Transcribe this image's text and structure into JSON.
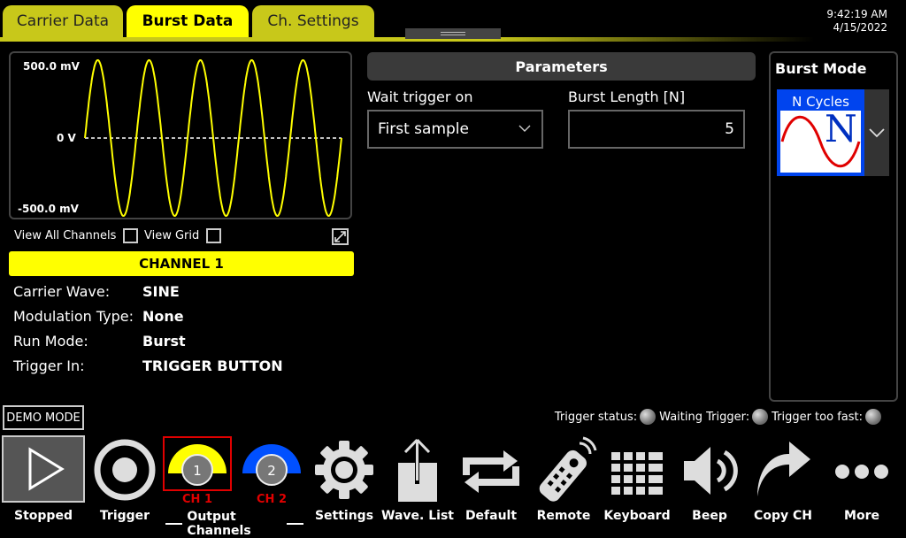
{
  "tabs": [
    {
      "label": "Carrier Data",
      "active": false
    },
    {
      "label": "Burst Data",
      "active": true
    },
    {
      "label": "Ch. Settings",
      "active": false
    }
  ],
  "clock": {
    "time": "9:42:19 AM",
    "date": "4/15/2022"
  },
  "waveform": {
    "top_label": "500.0 mV",
    "mid_label": "0 V",
    "bottom_label": "-500.0 mV",
    "cycles": 5,
    "color": "#ffff00"
  },
  "view": {
    "all_channels_label": "View All Channels",
    "grid_label": "View Grid",
    "all_channels_checked": false,
    "grid_checked": false
  },
  "channel": {
    "title": "CHANNEL 1",
    "color": "#ffff00"
  },
  "info": [
    {
      "label": "Carrier Wave:",
      "value": "SINE"
    },
    {
      "label": "Modulation Type:",
      "value": "None"
    },
    {
      "label": "Run Mode:",
      "value": "Burst"
    },
    {
      "label": "Trigger In:",
      "value": "TRIGGER BUTTON"
    }
  ],
  "parameters": {
    "title": "Parameters",
    "wait_trigger_label": "Wait trigger on",
    "wait_trigger_value": "First sample",
    "burst_length_label": "Burst Length [N]",
    "burst_length_value": "5"
  },
  "burst_mode": {
    "title": "Burst Mode",
    "selected": "N Cycles",
    "glyph": "N"
  },
  "demo_mode": "DEMO MODE",
  "trigger_status": [
    {
      "label": "Trigger status:"
    },
    {
      "label": "Waiting Trigger:"
    },
    {
      "label": "Trigger too fast:"
    }
  ],
  "toolbar": {
    "stopped": "Stopped",
    "trigger": "Trigger",
    "ch1": "CH 1",
    "ch1_num": "1",
    "ch2": "CH 2",
    "ch2_num": "2",
    "output_channels": "Output Channels",
    "settings": "Settings",
    "wave_list": "Wave. List",
    "default": "Default",
    "remote": "Remote",
    "keyboard": "Keyboard",
    "beep": "Beep",
    "copy_ch": "Copy CH",
    "more": "More"
  },
  "colors": {
    "ch1": "#ffff00",
    "ch2": "#0050ff",
    "tab": "#c8c81a",
    "status_red": "#e00000"
  }
}
